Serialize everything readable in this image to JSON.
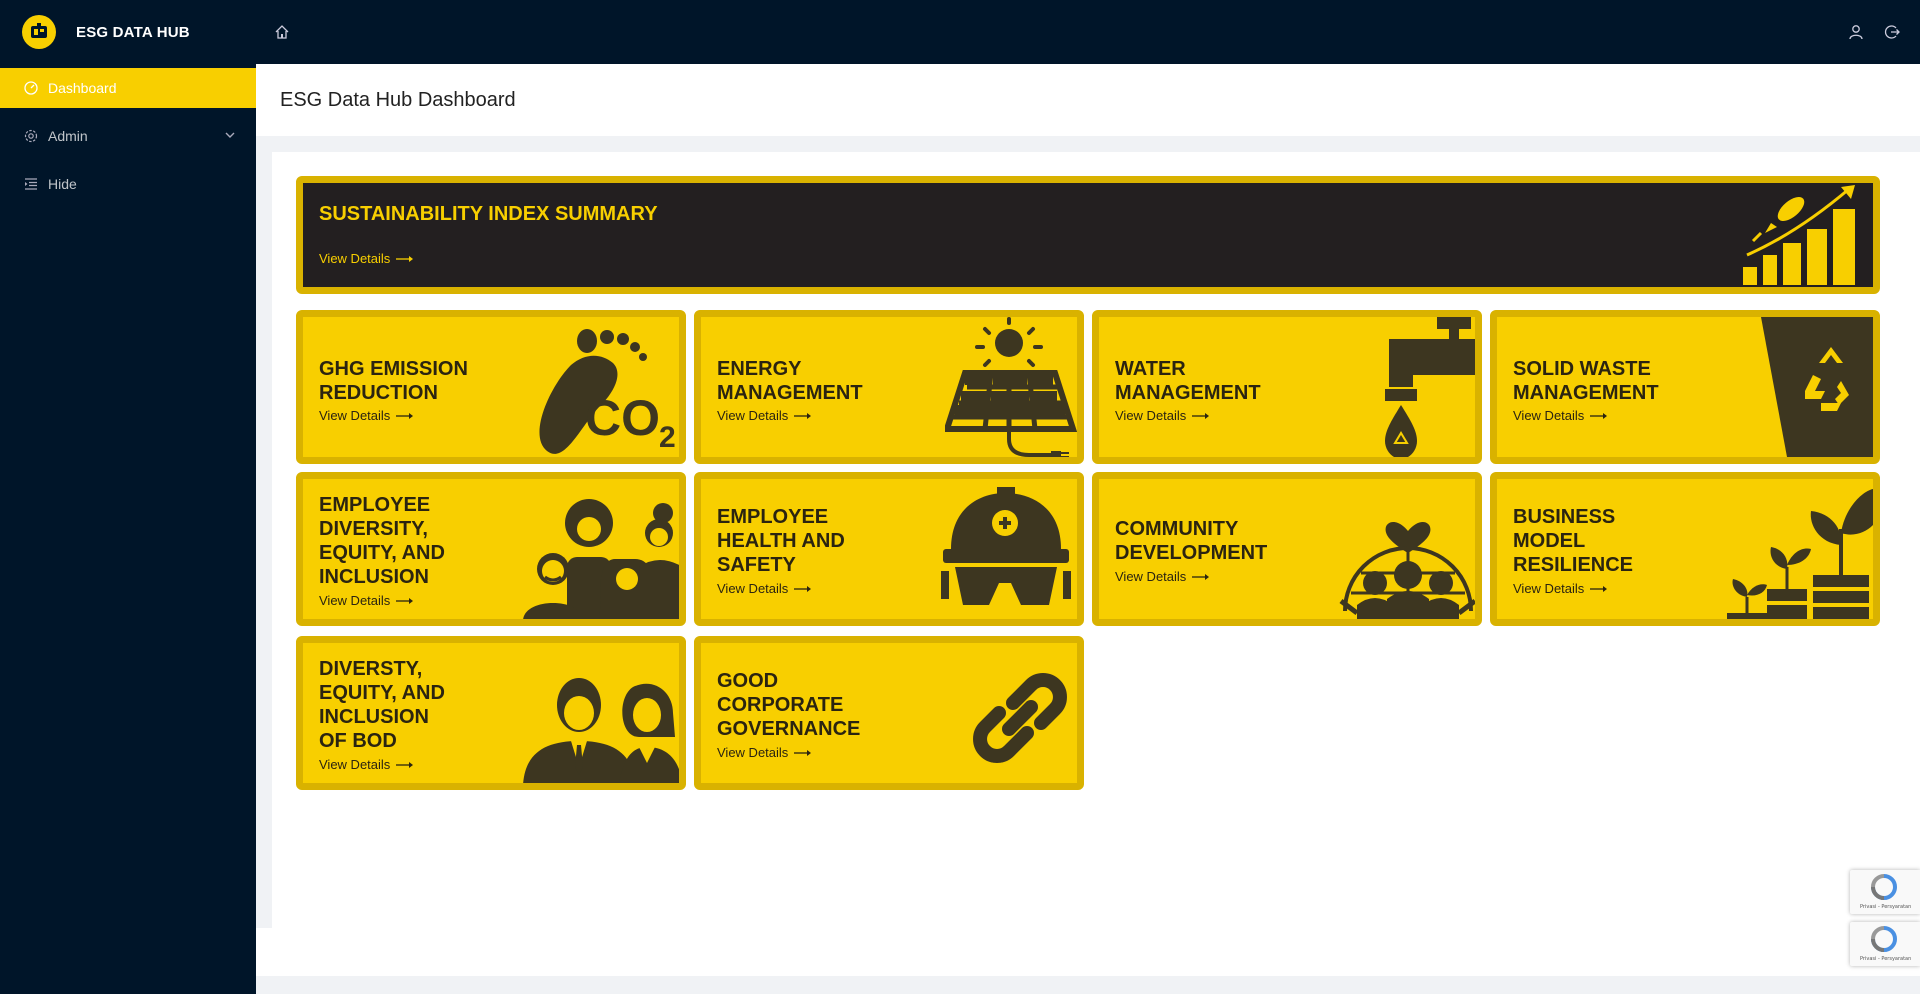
{
  "app": {
    "brand": "ESG DATA HUB"
  },
  "sidebar": {
    "items": [
      {
        "label": "Dashboard",
        "icon": "dashboard-icon",
        "active": true
      },
      {
        "label": "Admin",
        "icon": "gear-icon",
        "active": false
      },
      {
        "label": "Hide",
        "icon": "menu-fold-icon",
        "active": false
      }
    ]
  },
  "header": {
    "icons": [
      "home-icon",
      "user-icon",
      "logout-icon"
    ]
  },
  "page": {
    "title": "ESG Data Hub Dashboard"
  },
  "cards": {
    "summary": {
      "title": "SUSTAINABILITY INDEX SUMMARY",
      "link": "View Details"
    },
    "ghg": {
      "title_lines": [
        "GHG EMISSION",
        "REDUCTION"
      ],
      "link": "View Details",
      "art_text": "CO₂"
    },
    "energy": {
      "title_lines": [
        "ENERGY",
        "MANAGEMENT"
      ],
      "link": "View Details"
    },
    "water": {
      "title_lines": [
        "WATER",
        "MANAGEMENT"
      ],
      "link": "View Details"
    },
    "waste": {
      "title_lines": [
        "SOLID WASTE",
        "MANAGEMENT"
      ],
      "link": "View Details"
    },
    "dei": {
      "title_lines": [
        "EMPLOYEE",
        "DIVERSITY,",
        "EQUITY, AND",
        "INCLUSION"
      ],
      "link": "View Details"
    },
    "health": {
      "title_lines": [
        "EMPLOYEE",
        "HEALTH AND",
        "SAFETY"
      ],
      "link": "View Details"
    },
    "community": {
      "title_lines": [
        "COMMUNITY",
        "DEVELOPMENT"
      ],
      "link": "View Details"
    },
    "business": {
      "title_lines": [
        "BUSINESS",
        "MODEL",
        "RESILIENCE"
      ],
      "link": "View Details"
    },
    "bod": {
      "title_lines": [
        "DIVERSTY,",
        "EQUITY, AND",
        "INCLUSION",
        "OF BOD"
      ],
      "link": "View Details"
    },
    "governance": {
      "title_lines": [
        "GOOD",
        "CORPORATE",
        "GOVERNANCE"
      ],
      "link": "View Details"
    }
  },
  "recaptcha": {
    "text": "Privasi - Persyaratan"
  },
  "colors": {
    "sidebar": "#001529",
    "accent": "#f8cf00",
    "card_border": "#d9b200",
    "dark_card": "#231f20",
    "art": "#3d3620"
  }
}
